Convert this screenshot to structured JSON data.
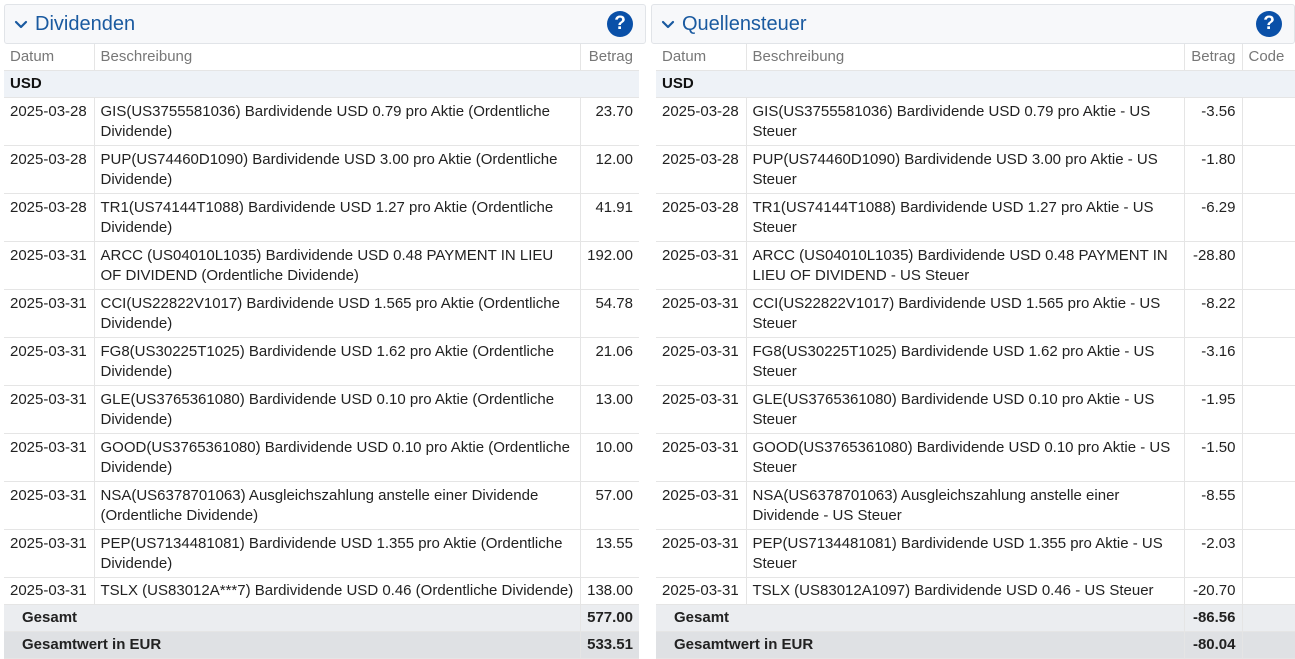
{
  "dividenden": {
    "title": "Dividenden",
    "help_label": "?",
    "columns": {
      "datum": "Datum",
      "beschreibung": "Beschreibung",
      "betrag": "Betrag"
    },
    "group": "USD",
    "rows": [
      {
        "date": "2025-03-28",
        "desc": "GIS(US3755581036) Bardividende USD 0.79 pro Aktie (Ordentliche Dividende)",
        "amount": "23.70"
      },
      {
        "date": "2025-03-28",
        "desc": "PUP(US74460D1090) Bardividende USD 3.00 pro Aktie (Ordentliche Dividende)",
        "amount": "12.00"
      },
      {
        "date": "2025-03-28",
        "desc": "TR1(US74144T1088) Bardividende USD 1.27 pro Aktie (Ordentliche Dividende)",
        "amount": "41.91"
      },
      {
        "date": "2025-03-31",
        "desc": "ARCC (US04010L1035) Bardividende USD 0.48 PAYMENT IN LIEU OF DIVIDEND (Ordentliche Dividende)",
        "amount": "192.00"
      },
      {
        "date": "2025-03-31",
        "desc": "CCI(US22822V1017) Bardividende USD 1.565 pro Aktie (Ordentliche Dividende)",
        "amount": "54.78"
      },
      {
        "date": "2025-03-31",
        "desc": "FG8(US30225T1025) Bardividende USD 1.62 pro Aktie (Ordentliche Dividende)",
        "amount": "21.06"
      },
      {
        "date": "2025-03-31",
        "desc": "GLE(US3765361080) Bardividende USD 0.10 pro Aktie (Ordentliche Dividende)",
        "amount": "13.00"
      },
      {
        "date": "2025-03-31",
        "desc": "GOOD(US3765361080) Bardividende USD 0.10 pro Aktie (Ordentliche Dividende)",
        "amount": "10.00"
      },
      {
        "date": "2025-03-31",
        "desc": "NSA(US6378701063) Ausgleichszahlung anstelle einer Dividende (Ordentliche Dividende)",
        "amount": "57.00"
      },
      {
        "date": "2025-03-31",
        "desc": "PEP(US7134481081) Bardividende USD 1.355 pro Aktie (Ordentliche Dividende)",
        "amount": "13.55"
      },
      {
        "date": "2025-03-31",
        "desc": "TSLX (US83012A***7) Bardividende USD 0.46 (Ordentliche Dividende)",
        "amount": "138.00"
      }
    ],
    "total_label": "Gesamt",
    "total": "577.00",
    "total_eur_label": "Gesamtwert in EUR",
    "total_eur": "533.51"
  },
  "quellensteuer": {
    "title": "Quellensteuer",
    "help_label": "?",
    "columns": {
      "datum": "Datum",
      "beschreibung": "Beschreibung",
      "betrag": "Betrag",
      "code": "Code"
    },
    "group": "USD",
    "rows": [
      {
        "date": "2025-03-28",
        "desc": "GIS(US3755581036) Bardividende USD 0.79 pro Aktie - US Steuer",
        "amount": "-3.56"
      },
      {
        "date": "2025-03-28",
        "desc": "PUP(US74460D1090) Bardividende USD 3.00 pro Aktie - US Steuer",
        "amount": "-1.80"
      },
      {
        "date": "2025-03-28",
        "desc": "TR1(US74144T1088) Bardividende USD 1.27 pro Aktie - US Steuer",
        "amount": "-6.29"
      },
      {
        "date": "2025-03-31",
        "desc": "ARCC (US04010L1035) Bardividende USD 0.48 PAYMENT IN LIEU OF DIVIDEND - US Steuer",
        "amount": "-28.80"
      },
      {
        "date": "2025-03-31",
        "desc": "CCI(US22822V1017) Bardividende USD 1.565 pro Aktie - US Steuer",
        "amount": "-8.22"
      },
      {
        "date": "2025-03-31",
        "desc": "FG8(US30225T1025) Bardividende USD 1.62 pro Aktie - US Steuer",
        "amount": "-3.16"
      },
      {
        "date": "2025-03-31",
        "desc": "GLE(US3765361080) Bardividende USD 0.10 pro Aktie - US Steuer",
        "amount": "-1.95"
      },
      {
        "date": "2025-03-31",
        "desc": "GOOD(US3765361080) Bardividende USD 0.10 pro Aktie - US Steuer",
        "amount": "-1.50"
      },
      {
        "date": "2025-03-31",
        "desc": "NSA(US6378701063) Ausgleichszahlung anstelle einer Dividende - US Steuer",
        "amount": "-8.55"
      },
      {
        "date": "2025-03-31",
        "desc": "PEP(US7134481081) Bardividende USD 1.355 pro Aktie - US Steuer",
        "amount": "-2.03"
      },
      {
        "date": "2025-03-31",
        "desc": "TSLX (US83012A1097) Bardividende USD 0.46 - US Steuer",
        "amount": "-20.70"
      }
    ],
    "total_label": "Gesamt",
    "total": "-86.56",
    "total_eur_label": "Gesamtwert in EUR",
    "total_eur": "-80.04"
  }
}
